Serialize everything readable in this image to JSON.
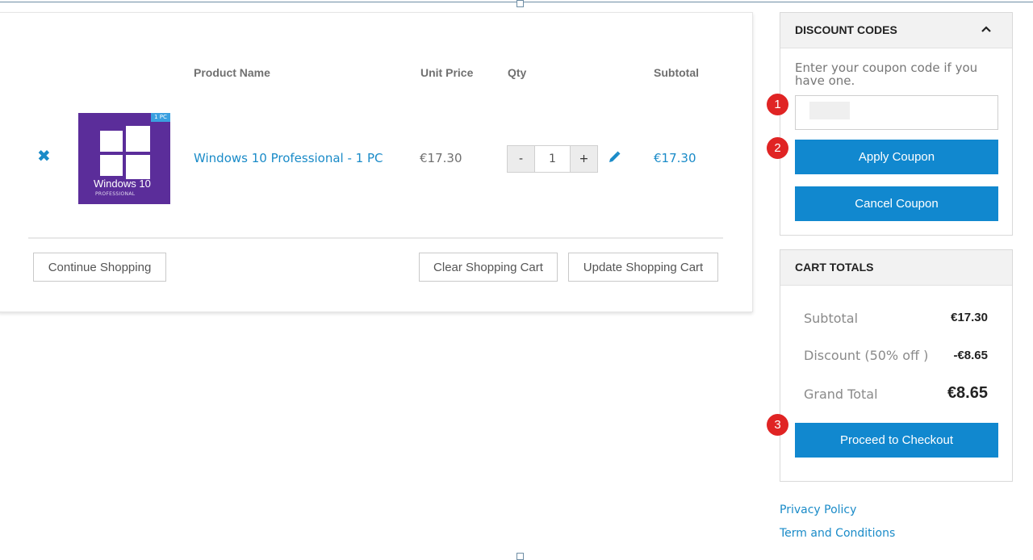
{
  "cart": {
    "headers": {
      "product_name": "Product Name",
      "unit_price": "Unit Price",
      "qty": "Qty",
      "subtotal": "Subtotal"
    },
    "item": {
      "remove_glyph": "✖",
      "thumb": {
        "pc_tag": "1 PC",
        "brand": "Windows 10",
        "sub": "PROFESSIONAL"
      },
      "name": "Windows 10 Professional - 1 PC",
      "unit_price": "€17.30",
      "qty": "1",
      "qty_minus": "-",
      "qty_plus": "+",
      "subtotal": "€17.30"
    },
    "buttons": {
      "continue": "Continue Shopping",
      "clear": "Clear Shopping Cart",
      "update": "Update Shopping Cart"
    }
  },
  "discount": {
    "title": "DISCOUNT CODES",
    "hint": "Enter your coupon code if you have one.",
    "coupon_value": "",
    "apply": "Apply Coupon",
    "cancel": "Cancel Coupon"
  },
  "totals": {
    "title": "CART TOTALS",
    "rows": [
      {
        "label": "Subtotal",
        "value": "€17.30"
      },
      {
        "label": "Discount (50% off )",
        "value": "-€8.65"
      },
      {
        "label": "Grand Total",
        "value": "€8.65"
      }
    ],
    "checkout": "Proceed to Checkout"
  },
  "badges": [
    "1",
    "2",
    "3"
  ],
  "footer": {
    "privacy": "Privacy Policy",
    "terms": "Term and Conditions"
  },
  "colors": {
    "accent": "#1188cf",
    "link": "#1a8bc8",
    "badge": "#e02424",
    "product_bg": "#5b2d9a"
  }
}
